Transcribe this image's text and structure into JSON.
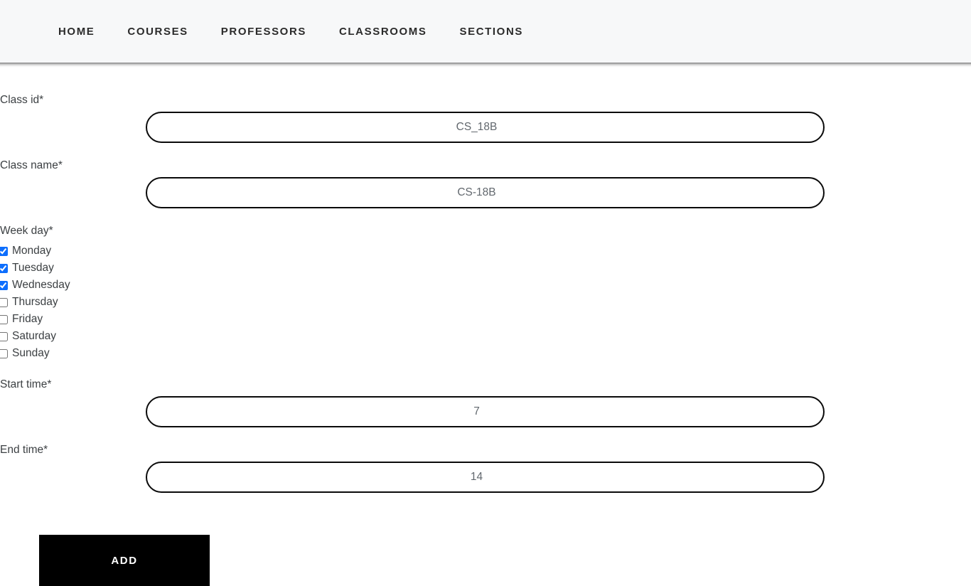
{
  "navbar": {
    "items": [
      {
        "label": "HOME",
        "name": "nav-item-home"
      },
      {
        "label": "COURSES",
        "name": "nav-item-courses"
      },
      {
        "label": "PROFESSORS",
        "name": "nav-item-professors"
      },
      {
        "label": "CLASSROOMS",
        "name": "nav-item-classrooms"
      },
      {
        "label": "SECTIONS",
        "name": "nav-item-sections"
      }
    ],
    "background_color": "#f7f8f9",
    "text_color": "#2b2b2b"
  },
  "form": {
    "class_id": {
      "label": "Class id*",
      "value": "CS_18B",
      "placeholder": "CS_18B"
    },
    "class_name": {
      "label": "Class name*",
      "value": "CS-18B",
      "placeholder": "CS-18B"
    },
    "week_day": {
      "label": "Week day*",
      "options": [
        {
          "label": "Monday",
          "checked": true
        },
        {
          "label": "Tuesday",
          "checked": true
        },
        {
          "label": "Wednesday",
          "checked": true
        },
        {
          "label": "Thursday",
          "checked": false
        },
        {
          "label": "Friday",
          "checked": false
        },
        {
          "label": "Saturday",
          "checked": false
        },
        {
          "label": "Sunday",
          "checked": false
        }
      ],
      "checked_color": "#0d6efd"
    },
    "start_time": {
      "label": "Start time*",
      "value": "7",
      "placeholder": "7"
    },
    "end_time": {
      "label": "End time*",
      "value": "14",
      "placeholder": "14"
    },
    "submit": {
      "label": "ADD",
      "background_color": "#000000",
      "text_color": "#ffffff"
    }
  }
}
